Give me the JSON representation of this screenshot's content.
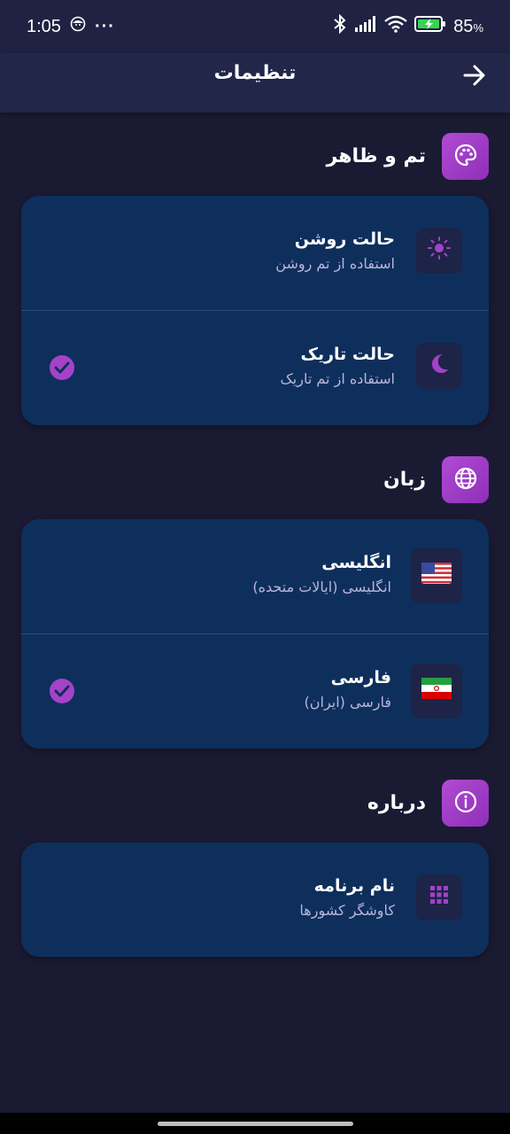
{
  "status_bar": {
    "time": "1:05",
    "dots": "···",
    "battery": "85",
    "battery_unit": "%"
  },
  "header": {
    "title": "تنظیمات",
    "back_icon": "arrow-right-icon"
  },
  "sections": {
    "theme": {
      "title": "تم و ظاهر",
      "icon": "palette-icon",
      "items": [
        {
          "title": "حالت روشن",
          "subtitle": "استفاده از تم روشن",
          "icon": "sun-icon",
          "selected": false
        },
        {
          "title": "حالت تاریک",
          "subtitle": "استفاده از تم تاریک",
          "icon": "moon-icon",
          "selected": true
        }
      ]
    },
    "language": {
      "title": "زبان",
      "icon": "globe-icon",
      "items": [
        {
          "title": "انگلیسی",
          "subtitle": "انگلیسی (ایالات متحده)",
          "icon": "us-flag-icon",
          "selected": false
        },
        {
          "title": "فارسی",
          "subtitle": "فارسی (ایران)",
          "icon": "iran-flag-icon",
          "selected": true
        }
      ]
    },
    "about": {
      "title": "درباره",
      "icon": "info-icon",
      "items": [
        {
          "title": "نام برنامه",
          "subtitle": "کاوشگر کشورها",
          "icon": "grid-icon"
        }
      ]
    }
  },
  "colors": {
    "background": "#1b1a33",
    "card": "#0e2f5c",
    "accent": "#a542c8"
  }
}
